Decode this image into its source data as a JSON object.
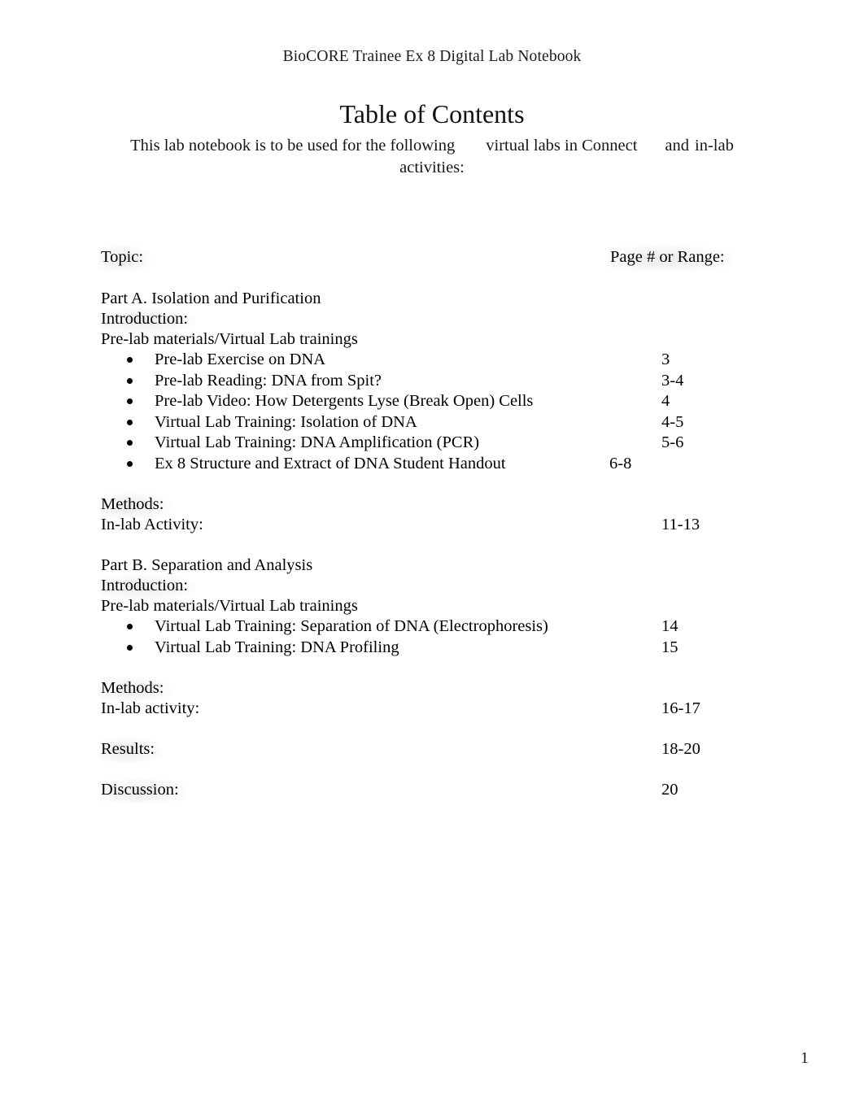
{
  "header": {
    "running_head": "BioCORE Trainee Ex 8 Digital Lab Notebook"
  },
  "title": "Table of Contents",
  "subtitle": {
    "part1": "This lab notebook is to be used for the following",
    "part2": "virtual labs in Connect",
    "part3": "and",
    "part4": "in-lab",
    "part5": "activities:"
  },
  "table": {
    "column_headers": {
      "topic": "Topic:",
      "page": "Page # or Range:"
    },
    "sections": [
      {
        "heading": "Part A. Isolation and Purification",
        "introduction": "Introduction:",
        "prelab_heading": "Pre-lab materials/Virtual Lab trainings",
        "items": [
          {
            "label": "Pre-lab Exercise on DNA",
            "pages": "3"
          },
          {
            "label": "Pre-lab Reading: DNA from Spit?",
            "pages": "3-4"
          },
          {
            "label": "Pre-lab Video: How Detergents Lyse (Break Open) Cells",
            "pages": "4"
          },
          {
            "label": "Virtual Lab Training: Isolation of DNA",
            "pages": "4-5"
          },
          {
            "label": "Virtual Lab Training: DNA Amplification (PCR)",
            "pages": "5-6"
          },
          {
            "label": "Ex 8 Structure and Extract of DNA Student Handout",
            "pages": "6-8"
          }
        ],
        "methods": "Methods:",
        "inlab_label": "In-lab Activity:",
        "inlab_pages": "11-13"
      },
      {
        "heading": "Part B. Separation and Analysis",
        "introduction": "Introduction:",
        "prelab_heading": "Pre-lab materials/Virtual Lab trainings",
        "items": [
          {
            "label": "Virtual Lab Training: Separation of DNA (Electrophoresis)",
            "pages": "14"
          },
          {
            "label": "Virtual Lab Training: DNA Profiling",
            "pages": "15"
          }
        ],
        "methods": "Methods:",
        "inlab_label": "In-lab activity:",
        "inlab_pages": "16-17"
      }
    ],
    "results_label": "Results:",
    "results_pages": "18-20",
    "discussion_label": "Discussion:",
    "discussion_pages": "20"
  },
  "footer": {
    "page_number": "1"
  }
}
